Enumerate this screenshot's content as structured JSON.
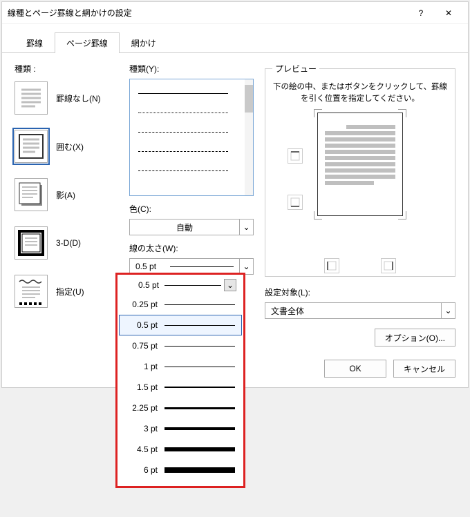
{
  "titlebar": {
    "title": "線種とページ罫線と網かけの設定",
    "help": "?",
    "close": "✕"
  },
  "tabs": {
    "border": "罫線",
    "page_border": "ページ罫線",
    "shading": "網かけ"
  },
  "col1": {
    "label": "種類 :",
    "none": "罫線なし(N)",
    "box": "囲む(X)",
    "shadow": "影(A)",
    "threeD": "3-D(D)",
    "custom": "指定(U)"
  },
  "style": {
    "label": "種類(Y):"
  },
  "color": {
    "label": "色(C):",
    "value": "自動"
  },
  "width": {
    "label": "線の太さ(W):",
    "selected": "0.5 pt",
    "options": [
      "0.25 pt",
      "0.5 pt",
      "0.75 pt",
      "1 pt",
      "1.5 pt",
      "2.25 pt",
      "3 pt",
      "4.5 pt",
      "6 pt"
    ],
    "thickness_px": [
      "1",
      "1",
      "1",
      "1",
      "2",
      "3",
      "4",
      "6",
      "8"
    ]
  },
  "preview": {
    "legend": "プレビュー",
    "instruction": "下の絵の中、またはボタンをクリックして、罫線を引く位置を指定してください。"
  },
  "apply": {
    "label": "設定対象(L):",
    "value": "文書全体"
  },
  "buttons": {
    "options": "オプション(O)...",
    "ok": "OK",
    "cancel": "キャンセル"
  }
}
